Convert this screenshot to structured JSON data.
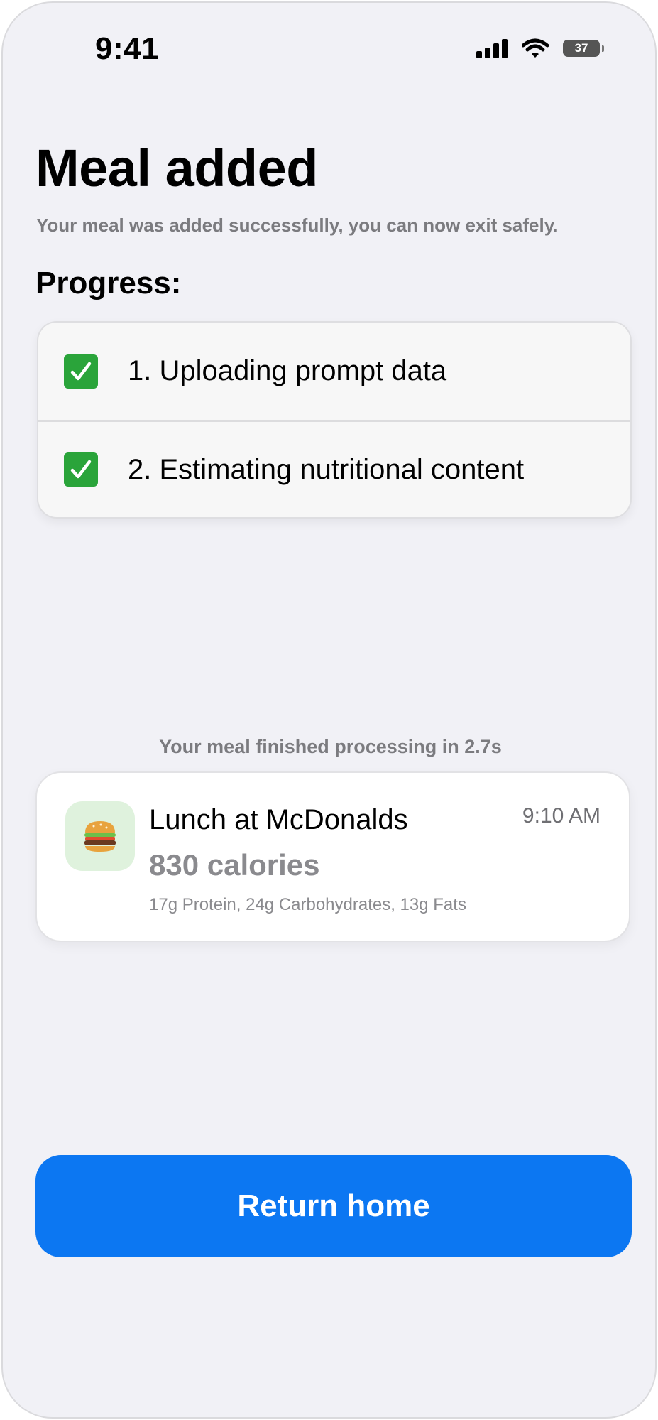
{
  "status_bar": {
    "time": "9:41",
    "battery_level": "37",
    "icons": [
      "signal-icon",
      "wifi-icon",
      "battery-icon"
    ]
  },
  "header": {
    "title": "Meal added",
    "subtitle": "Your meal was added successfully, you can now exit safely."
  },
  "progress": {
    "heading": "Progress:",
    "steps": [
      {
        "label": "1. Uploading prompt data",
        "icon": "check-icon",
        "done": true
      },
      {
        "label": "2. Estimating nutritional content",
        "icon": "check-icon",
        "done": true
      }
    ]
  },
  "processing_note": "Your meal finished processing in 2.7s",
  "meal": {
    "icon": "burger-icon",
    "name": "Lunch at McDonalds",
    "time": "9:10 AM",
    "calories": "830 calories",
    "macros": "17g Protein, 24g Carbohydrates, 13g Fats"
  },
  "actions": {
    "return_home_label": "Return home"
  },
  "colors": {
    "background": "#f1f1f6",
    "accent": "#0c77f2",
    "check": "#2aa43a",
    "meal_tile": "#dff2dd",
    "secondary_text": "#7b7b7f"
  }
}
